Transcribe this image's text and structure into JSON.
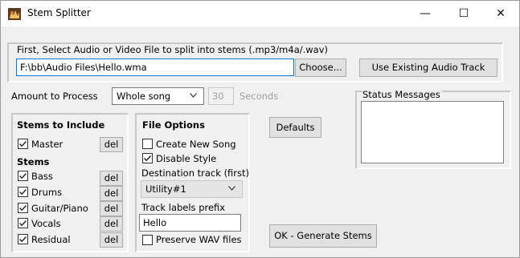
{
  "window": {
    "title": "Stem Splitter",
    "minimize_glyph": "—",
    "maximize_glyph": "☐",
    "close_glyph": "✕",
    "app_icon": "band-in-a-box-icon"
  },
  "source": {
    "section_label": "First, Select Audio or Video  File to split into stems (.mp3/m4a/.wav)",
    "file_path": "F:\\bb\\Audio Files\\Hello.wma",
    "choose_label": "Choose...",
    "use_existing_label": "Use Existing Audio Track"
  },
  "amount": {
    "label": "Amount to Process",
    "selected": "Whole song",
    "seconds_value": "30",
    "seconds_label": "Seconds"
  },
  "stems_group": {
    "title": "Stems to Include",
    "master_label": "Master",
    "master_checked": true,
    "del_label": "del",
    "stems_title": "Stems",
    "stems": [
      {
        "label": "Bass",
        "checked": true
      },
      {
        "label": "Drums",
        "checked": true
      },
      {
        "label": "Guitar/Piano",
        "checked": true
      },
      {
        "label": "Vocals",
        "checked": true
      },
      {
        "label": "Residual",
        "checked": true
      }
    ]
  },
  "file_options": {
    "title": "File Options",
    "create_new_song_label": "Create New Song",
    "create_new_song_checked": false,
    "disable_style_label": "Disable Style",
    "disable_style_checked": true,
    "destination_label": "Destination track (first)",
    "destination_selected": "Utility#1",
    "prefix_label": "Track labels prefix",
    "prefix_value": "Hello",
    "preserve_wav_label": "Preserve WAV files",
    "preserve_wav_checked": false
  },
  "defaults_label": "Defaults",
  "status": {
    "label": "Status Messages",
    "content": ""
  },
  "ok_label": "OK - Generate Stems"
}
